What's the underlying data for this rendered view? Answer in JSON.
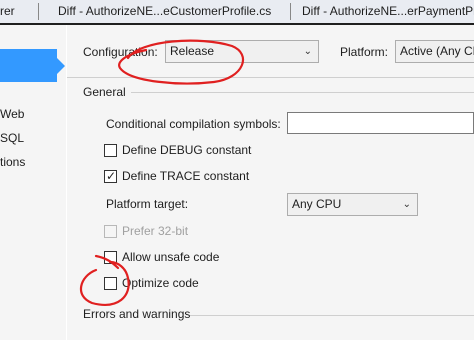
{
  "tabs": [
    {
      "label": "rer"
    },
    {
      "label": "Diff - AuthorizeNE...eCustomerProfile.cs"
    },
    {
      "label": "Diff - AuthorizeNE...erPaymentProfile."
    }
  ],
  "nav": {
    "items": [
      {
        "label": "Web"
      },
      {
        "label": "SQL"
      },
      {
        "label": "tions"
      }
    ]
  },
  "top": {
    "configuration_label": "Configuration:",
    "configuration_value": "Release",
    "platform_label": "Platform:",
    "platform_value": "Active (Any CPU)"
  },
  "general": {
    "title": "General",
    "conditional_symbols_label": "Conditional compilation symbols:",
    "conditional_symbols_value": "",
    "define_debug_label": "Define DEBUG constant",
    "define_debug_checked": false,
    "define_trace_label": "Define TRACE constant",
    "define_trace_checked": true,
    "platform_target_label": "Platform target:",
    "platform_target_value": "Any CPU",
    "prefer32_label": "Prefer 32-bit",
    "prefer32_enabled": false,
    "allow_unsafe_label": "Allow unsafe code",
    "allow_unsafe_checked": false,
    "optimize_label": "Optimize code",
    "optimize_checked": false
  },
  "errors": {
    "title": "Errors and warnings"
  },
  "icons": {
    "dropdown": "chevron-down-icon",
    "check": "check-icon"
  },
  "colors": {
    "accent": "#3399ff",
    "annotation": "#e02020"
  }
}
